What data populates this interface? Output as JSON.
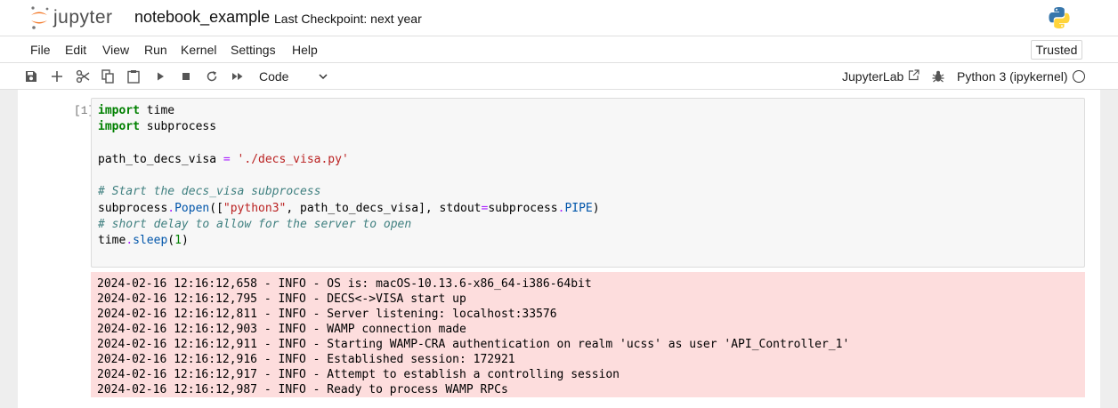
{
  "header": {
    "logo_text": "jupyter",
    "notebook_name": "notebook_example",
    "checkpoint": "Last Checkpoint: next year"
  },
  "menu": {
    "items": [
      "File",
      "Edit",
      "View",
      "Run",
      "Kernel",
      "Settings",
      "Help"
    ],
    "trusted": "Trusted"
  },
  "toolbar": {
    "icons": [
      "save-icon",
      "add-icon",
      "cut-icon",
      "copy-icon",
      "paste-icon",
      "run-icon",
      "stop-icon",
      "restart-icon",
      "run-all-icon"
    ],
    "cell_type": "Code",
    "jupyterlab": "JupyterLab",
    "kernel": "Python 3 (ipykernel)"
  },
  "cell": {
    "prompt": "[1]:",
    "code_lines": [
      "import time",
      "import subprocess",
      "",
      "path_to_decs_visa = './decs_visa.py'",
      "",
      "# Start the decs_visa subprocess",
      "subprocess.Popen([\"python3\", path_to_decs_visa], stdout=subprocess.PIPE)",
      "# short delay to allow for the server to open",
      "time.sleep(1)"
    ],
    "output_lines": [
      "2024-02-16 12:16:12,658 - INFO - OS is: macOS-10.13.6-x86_64-i386-64bit",
      "2024-02-16 12:16:12,795 - INFO - DECS<->VISA start up",
      "2024-02-16 12:16:12,811 - INFO - Server listening: localhost:33576",
      "2024-02-16 12:16:12,903 - INFO - WAMP connection made",
      "2024-02-16 12:16:12,911 - INFO - Starting WAMP-CRA authentication on realm 'ucss' as user 'API_Controller_1'",
      "2024-02-16 12:16:12,916 - INFO - Established session: 172921",
      "2024-02-16 12:16:12,917 - INFO - Attempt to establish a controlling session",
      "2024-02-16 12:16:12,987 - INFO - Ready to process WAMP RPCs"
    ]
  },
  "colors": {
    "output_background": "#fddddd",
    "jupyter_orange": "#f37726"
  }
}
